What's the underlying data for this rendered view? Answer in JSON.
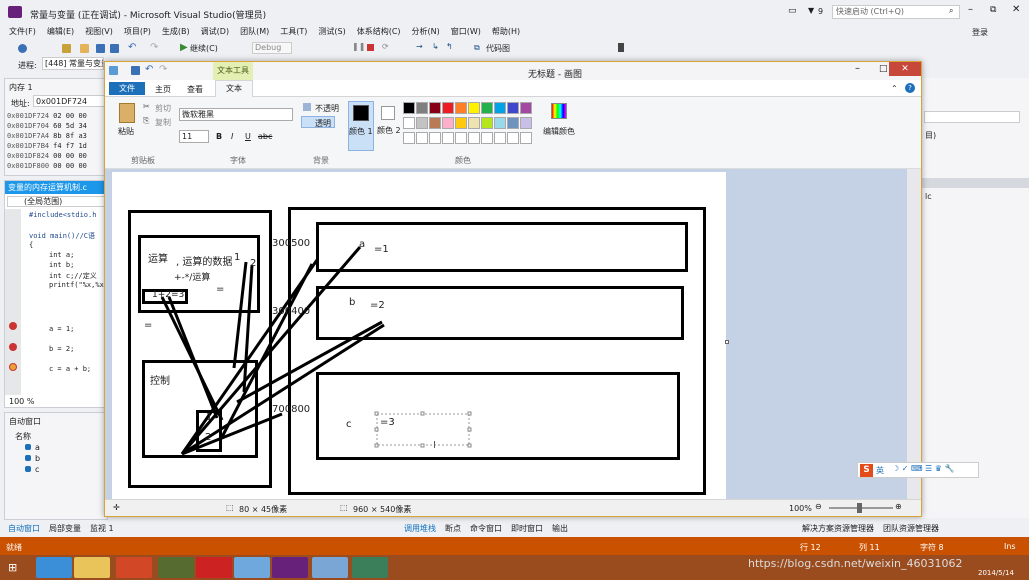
{
  "vs": {
    "title": "常量与变量 (正在调试) - Microsoft Visual Studio(管理员)",
    "filter_count": "9",
    "quick_launch_placeholder": "快速启动 (Ctrl+Q)",
    "login": "登录",
    "menu": [
      "文件(F)",
      "编辑(E)",
      "视图(V)",
      "项目(P)",
      "生成(B)",
      "调试(D)",
      "团队(M)",
      "工具(T)",
      "测试(S)",
      "体系结构(C)",
      "分析(N)",
      "窗口(W)",
      "帮助(H)"
    ],
    "toolbar": {
      "continue": "继续(C)",
      "config": "Debug",
      "code_map": "代码图"
    },
    "process_label": "进程:",
    "process_value": "[448] 常量与变量",
    "memory": {
      "title": "内存 1",
      "address_label": "地址:",
      "address_value": "0x001DF724",
      "rows": [
        {
          "addr": "0x001DF724",
          "bytes": "02 00 00"
        },
        {
          "addr": "0x001DF704",
          "bytes": "60 5d 34"
        },
        {
          "addr": "0x001DF7A4",
          "bytes": "8b 8f a3"
        },
        {
          "addr": "0x001DF7B4",
          "bytes": "f4 f7 1d"
        },
        {
          "addr": "0x001DF824",
          "bytes": "00 00 00"
        },
        {
          "addr": "0x001DF800",
          "bytes": "00 00 00"
        }
      ]
    },
    "editor": {
      "tab": "变量的内存运算机制.c",
      "scope": "(全局范围)",
      "lines": [
        "#include<stdio.h",
        "void main()//C语",
        "{",
        "int a;",
        "int b;",
        "int c;//定义",
        "printf(\"%x,%x",
        "a = 1;",
        "b = 2;",
        "c = a + b;"
      ],
      "zoom": "100 %"
    },
    "autos": {
      "title": "自动窗口",
      "header": "名称",
      "items": [
        "a",
        "b",
        "c"
      ]
    },
    "bottom_tabs_left": [
      "自动窗口",
      "局部变量",
      "监视 1"
    ],
    "bottom_tabs_right": [
      "调用堆栈",
      "断点",
      "命令窗口",
      "即时窗口",
      "输出"
    ],
    "right_tabs": [
      "解决方案资源管理器",
      "团队资源管理器"
    ],
    "right_panel_fragments": [
      "目)",
      "lc"
    ],
    "status": {
      "ready": "就绪",
      "line": "行 12",
      "col": "列 11",
      "char": "字符 8",
      "ins": "Ins"
    },
    "clock": {
      "date": "2014/5/14"
    },
    "watermark": "https://blog.csdn.net/weixin_46031062"
  },
  "paint": {
    "title": "无标题 - 画图",
    "context_tab": "文本工具",
    "tabs": [
      "文件",
      "主页",
      "查看",
      "文本"
    ],
    "clipboard": {
      "paste": "粘贴",
      "cut": "剪切",
      "copy": "复制",
      "group": "剪贴板"
    },
    "font": {
      "name": "微软雅黑",
      "size": "11",
      "bold": "B",
      "italic": "I",
      "underline": "U",
      "strike": "abc",
      "group": "字体"
    },
    "background": {
      "opaque": "不透明",
      "transparent": "透明",
      "group": "背景"
    },
    "colors": {
      "color1": "颜色 1",
      "color2": "颜色 2",
      "edit": "编辑颜色",
      "group": "颜色",
      "palette_row1": [
        "#000000",
        "#7f7f7f",
        "#880015",
        "#ed1c24",
        "#ff7f27",
        "#fff200",
        "#22b14c",
        "#00a2e8",
        "#3f48cc",
        "#a349a4"
      ],
      "palette_row2": [
        "#ffffff",
        "#c3c3c3",
        "#b97a57",
        "#ffaec9",
        "#ffc90e",
        "#efe4b0",
        "#b5e61d",
        "#99d9ea",
        "#7092be",
        "#c8bfe7"
      ]
    },
    "status": {
      "selection": "80 × 45像素",
      "size": "960 × 540像素",
      "zoom": "100%"
    },
    "ime": "英",
    "drawing": {
      "cpu_compute": "运算",
      "cpu_compute_desc": ", 运算的数据",
      "ops": "+-*/运算",
      "expr": "1+2=3",
      "one": "1",
      "two": "2",
      "eq_small": "=",
      "eq_left": "=",
      "control": "控制",
      "reg1": "1",
      "reg2": "2",
      "addr1": "300500",
      "addr2": "300400",
      "addr3": "700800",
      "var_a": "a",
      "val_a": "=1",
      "var_b": "b",
      "val_b": "=2",
      "var_c": "c",
      "val_c": "=3"
    }
  }
}
